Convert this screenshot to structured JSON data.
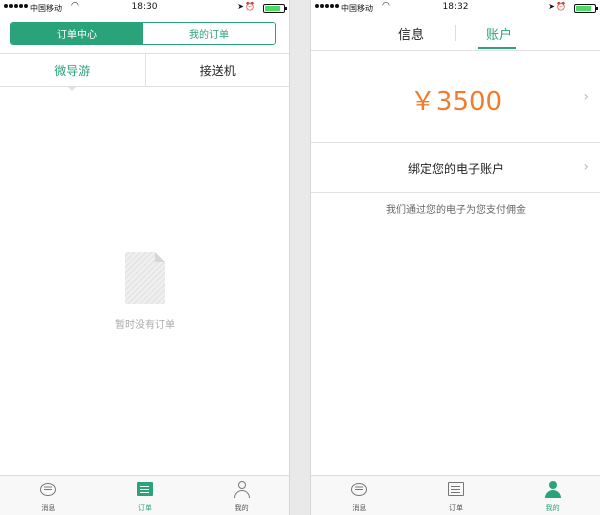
{
  "colors": {
    "accent": "#2aa37a",
    "amount": "#ef7d2c"
  },
  "left": {
    "status": {
      "carrier": "中国移动",
      "time": "18:30"
    },
    "segment": {
      "tabs": [
        {
          "label": "订单中心",
          "active": true
        },
        {
          "label": "我的订单",
          "active": false
        }
      ]
    },
    "subtabs": [
      {
        "label": "微导游",
        "active": true
      },
      {
        "label": "接送机",
        "active": false
      }
    ],
    "empty": {
      "icon": "document-icon",
      "text": "暂时没有订单"
    },
    "tabbar": [
      {
        "label": "消息",
        "icon": "message-icon",
        "active": false
      },
      {
        "label": "订单",
        "icon": "order-icon",
        "active": true
      },
      {
        "label": "我的",
        "icon": "user-icon",
        "active": false
      }
    ]
  },
  "right": {
    "status": {
      "carrier": "中国移动",
      "time": "18:32"
    },
    "tabs": [
      {
        "label": "信息",
        "active": false
      },
      {
        "label": "账户",
        "active": true
      }
    ],
    "amount": "￥3500",
    "bind_label": "绑定您的电子账户",
    "bind_note": "我们通过您的电子为您支付佣金",
    "tabbar": [
      {
        "label": "消息",
        "icon": "message-icon",
        "active": false
      },
      {
        "label": "订单",
        "icon": "order-icon",
        "active": false
      },
      {
        "label": "我的",
        "icon": "user-icon",
        "active": true
      }
    ]
  }
}
